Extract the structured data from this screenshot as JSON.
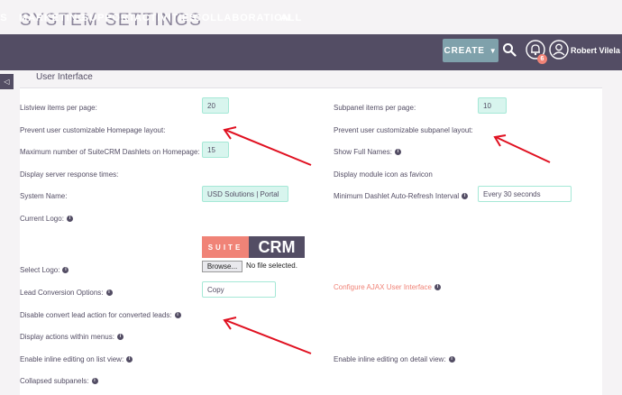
{
  "page": {
    "title": "SYSTEM SETTINGS"
  },
  "nav": {
    "items": [
      "ES",
      "MARKETING",
      "SUPPORT",
      "ACTIVITIES",
      "COLLABORATION",
      "ALL"
    ],
    "create_label": "CREATE",
    "notification_count": "6",
    "user_name": "Robert Vilela"
  },
  "panel": {
    "header": "User Interface"
  },
  "form": {
    "listview_label": "Listview items per page:",
    "listview_value": "20",
    "subpanel_label": "Subpanel items per page:",
    "subpanel_value": "10",
    "prevent_homepage_label": "Prevent user customizable Homepage layout:",
    "prevent_subpanel_label": "Prevent user customizable subpanel layout:",
    "max_dashlets_label": "Maximum number of SuiteCRM Dashlets on Homepage:",
    "max_dashlets_value": "15",
    "show_full_names_label": "Show Full Names:",
    "server_response_label": "Display server response times:",
    "favicon_label": "Display module icon as favicon",
    "system_name_label": "System Name:",
    "system_name_value": "USD Solutions | Portal",
    "min_refresh_label": "Minimum Dashlet Auto-Refresh Interval",
    "min_refresh_value": "Every 30 seconds",
    "current_logo_label": "Current Logo:",
    "logo_left": "SUITE",
    "logo_right": "CRM",
    "select_logo_label": "Select Logo:",
    "browse_label": "Browse...",
    "no_file_label": "No file selected.",
    "lead_conversion_label": "Lead Conversion Options:",
    "lead_conversion_value": "Copy",
    "configure_ajax_label": "Configure AJAX User Interface",
    "disable_convert_label": "Disable convert lead action for converted leads:",
    "actions_menus_label": "Display actions within menus:",
    "inline_list_label": "Enable inline editing on list view:",
    "inline_detail_label": "Enable inline editing on detail view:",
    "collapsed_subpanels_label": "Collapsed subpanels:"
  },
  "colors": {
    "navbar": "#534d64",
    "accent": "#f08377",
    "field_bg": "#d8f5ee",
    "arrow": "#e01020"
  }
}
